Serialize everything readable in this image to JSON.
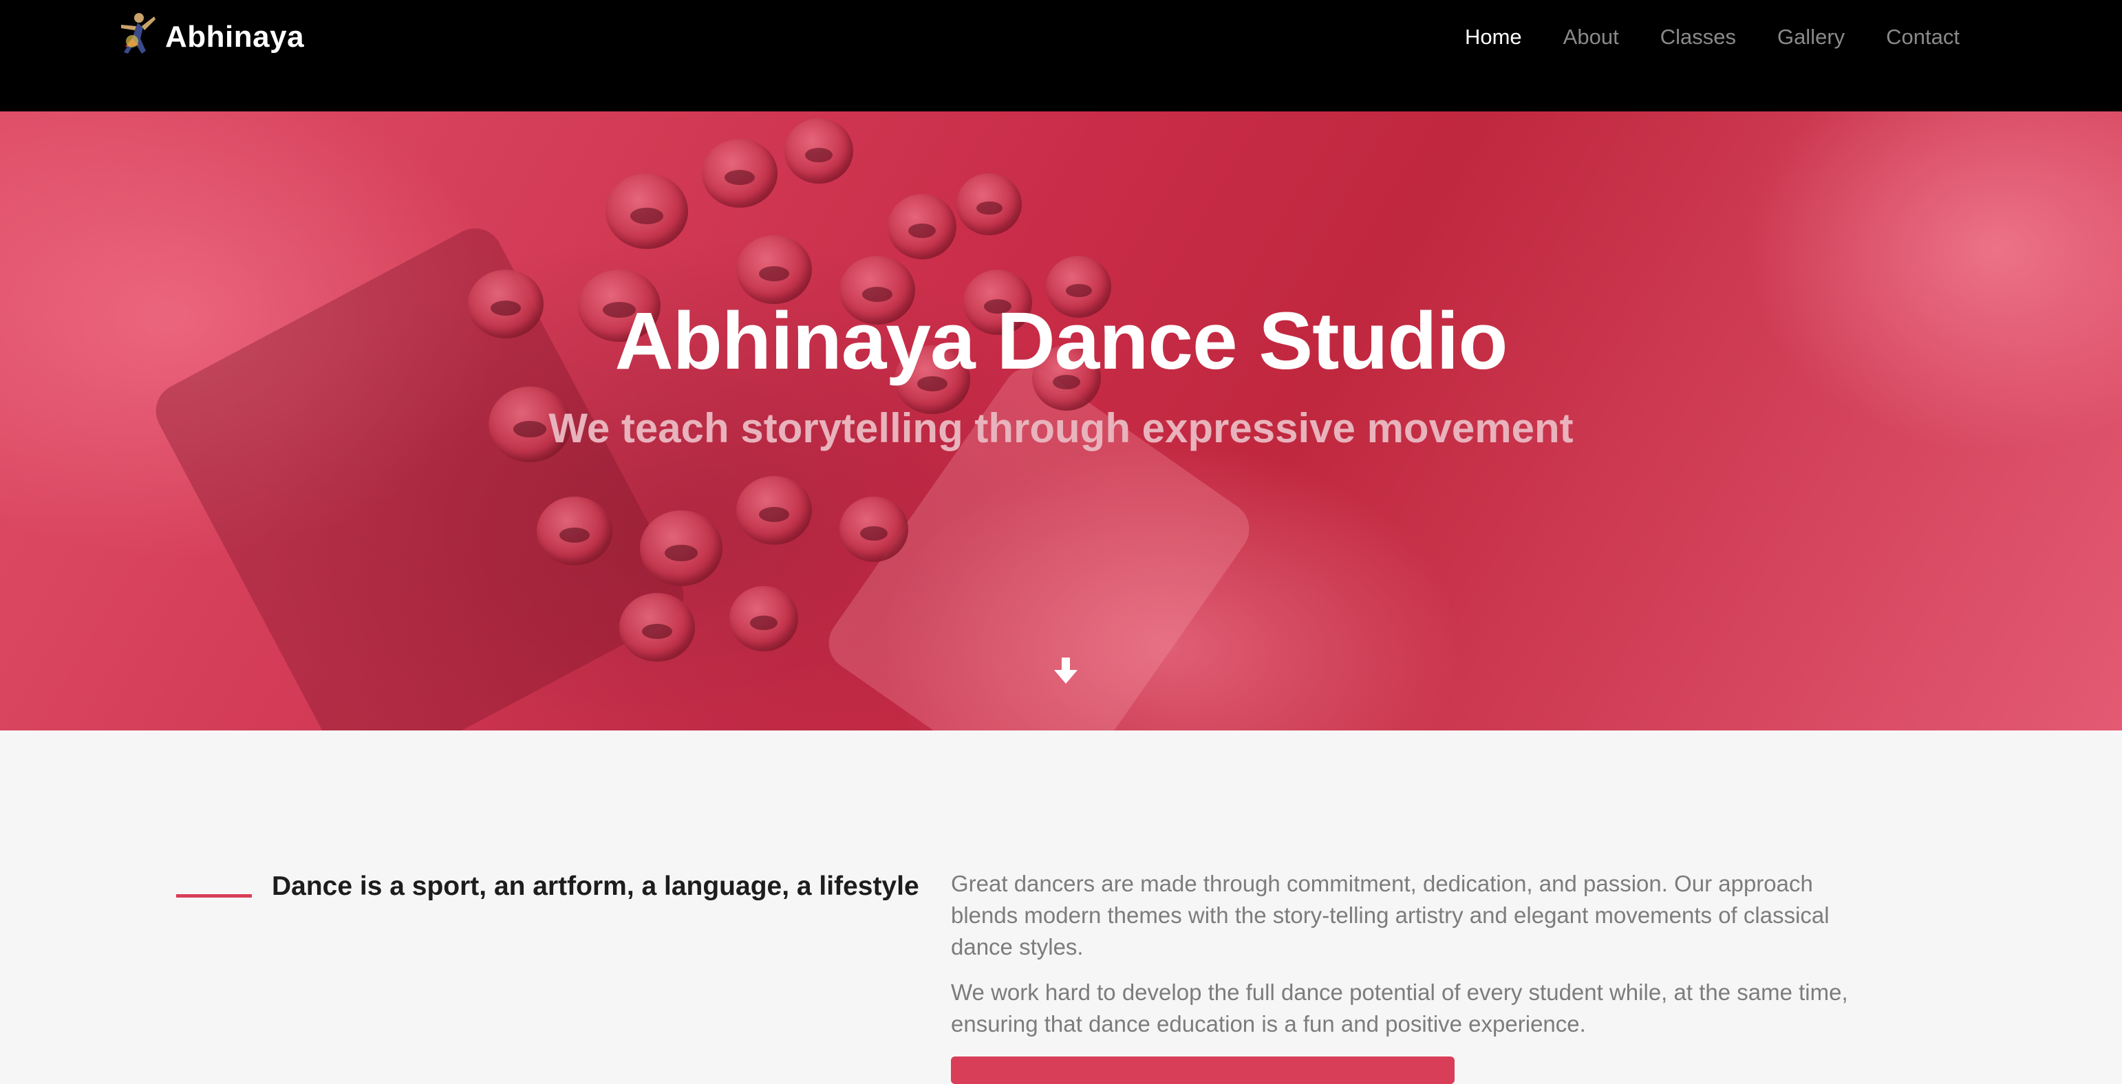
{
  "navbar": {
    "brand": "Abhinaya",
    "links": [
      {
        "label": "Home",
        "active": true
      },
      {
        "label": "About",
        "active": false
      },
      {
        "label": "Classes",
        "active": false
      },
      {
        "label": "Gallery",
        "active": false
      },
      {
        "label": "Contact",
        "active": false
      }
    ]
  },
  "hero": {
    "title": "Abhinaya Dance Studio",
    "subtitle": "We teach storytelling through expressive movement",
    "scroll_icon": "arrow-down-icon"
  },
  "about": {
    "heading": "Dance is a sport, an artform, a language, a lifestyle",
    "paragraphs": [
      "Great dancers are made through commitment, dedication, and passion. Our approach blends modern themes with the story-telling artistry and elegant movements of classical dance styles.",
      "We work hard to develop the full dance potential of every student while, at the same time, ensuring that dance education is a fun and positive experience."
    ]
  },
  "colors": {
    "accent": "#d83e58",
    "nav_bg": "#000000",
    "page_bg": "#f6f6f6"
  }
}
